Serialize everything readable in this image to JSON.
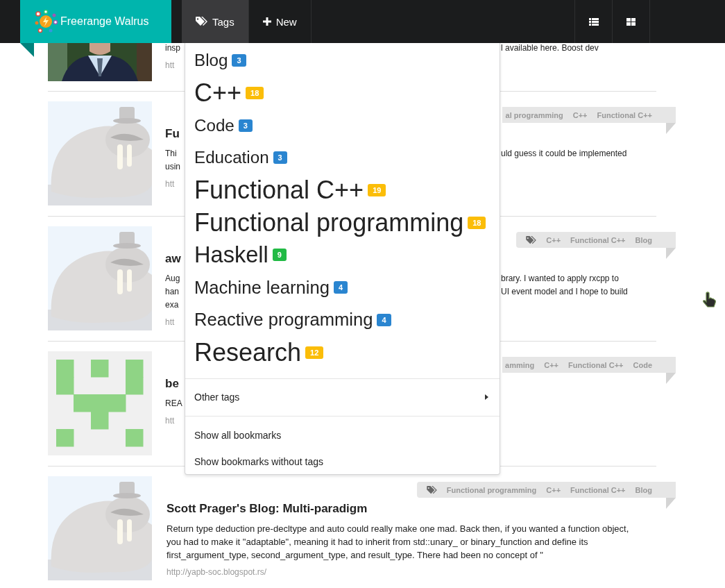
{
  "navbar": {
    "brand": "Freerange Walrus",
    "items": [
      {
        "label": "Tags",
        "selected": true
      },
      {
        "label": "New",
        "selected": false
      }
    ]
  },
  "bookmarks": [
    {
      "kind": "clipped",
      "left": {
        "lines": [
          "insp"
        ],
        "url": "htt"
      },
      "right": {
        "lines": [
          "l available here. Boost dev"
        ]
      }
    },
    {
      "kind": "clipped",
      "left": {
        "title": "Fu",
        "lines": [
          "Thi",
          "usin"
        ],
        "url": "htt"
      },
      "right": {
        "lines": [
          "uld guess it could be implemented"
        ]
      },
      "tags": {
        "clipped": true,
        "items": [
          "al programming",
          "C++",
          "Functional C++"
        ]
      }
    },
    {
      "kind": "clipped",
      "left": {
        "title": "aw",
        "lines": [
          "Aug",
          "han",
          "exa"
        ],
        "url": "htt"
      },
      "right": {
        "lines": [
          "brary. I wanted to apply rxcpp to",
          "UI event model and I hope to build"
        ]
      },
      "tags": {
        "clipped": false,
        "items": [
          "C++",
          "Functional C++",
          "Blog"
        ]
      }
    },
    {
      "kind": "clipped",
      "left": {
        "title": "be",
        "lines": [
          "REA"
        ],
        "url": "htt"
      },
      "tags": {
        "clipped": true,
        "items": [
          "amming",
          "C++",
          "Functional C++",
          "Code"
        ]
      }
    },
    {
      "kind": "full",
      "title": "Scott Prager's Blog: Multi-paradigm",
      "description": "Return type deduction pre-decltype and auto could really make one mad. Back then, if you wanted a function object, you had to make it \"adaptable\", meaning it had to inherit from std::unary_ or binary_function and define its first_argument_type, second_argument_type, and result_type. There had been no concept of \"",
      "url": "http://yapb-soc.blogspot.rs/",
      "tags": {
        "clipped": false,
        "items": [
          "Functional programming",
          "C++",
          "Functional C++",
          "Blog"
        ]
      }
    }
  ],
  "tags_menu": {
    "tags": [
      {
        "name": "Blog",
        "count": "3"
      },
      {
        "name": "C++",
        "count": "18"
      },
      {
        "name": "Code",
        "count": "3"
      },
      {
        "name": "Education",
        "count": "3"
      },
      {
        "name": "Functional C++",
        "count": "19"
      },
      {
        "name": "Functional programming",
        "count": "18"
      },
      {
        "name": "Haskell",
        "count": "9"
      },
      {
        "name": "Machine learning",
        "count": "4"
      },
      {
        "name": "Reactive programming",
        "count": "4"
      },
      {
        "name": "Research",
        "count": "12"
      }
    ],
    "other": "Other tags",
    "links": [
      "Show all bookmarks",
      "Show bookmarks without tags"
    ]
  }
}
